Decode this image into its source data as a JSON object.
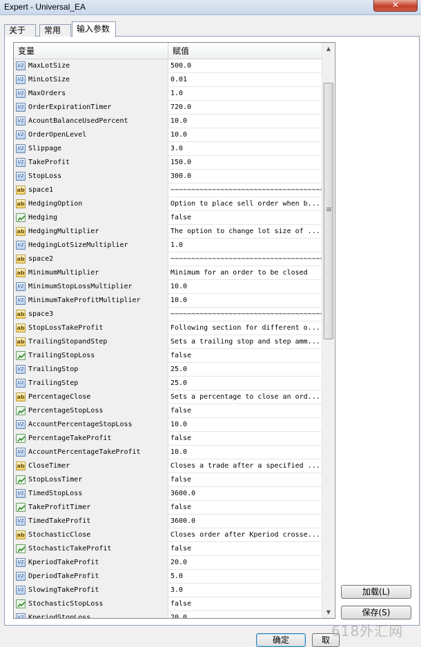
{
  "window": {
    "title": "Expert - Universal_EA",
    "close_label": "✕"
  },
  "tabs": [
    {
      "label": "关于"
    },
    {
      "label": "常用"
    },
    {
      "label": "输入参数"
    }
  ],
  "grid": {
    "col_variable": "变量",
    "col_value": "赋值",
    "rows": [
      {
        "name": "MaxLotSize",
        "value": "500.0",
        "type": "num"
      },
      {
        "name": "MinLotSize",
        "value": "0.01",
        "type": "num"
      },
      {
        "name": "MaxOrders",
        "value": "1.0",
        "type": "num"
      },
      {
        "name": "OrderExpirationTimer",
        "value": "720.0",
        "type": "num"
      },
      {
        "name": "AcountBalanceUsedPercent",
        "value": "10.0",
        "type": "num"
      },
      {
        "name": "OrderOpenLevel",
        "value": "10.0",
        "type": "num"
      },
      {
        "name": "Slippage",
        "value": "3.0",
        "type": "num"
      },
      {
        "name": "TakeProfit",
        "value": "150.0",
        "type": "num"
      },
      {
        "name": "StopLoss",
        "value": "300.0",
        "type": "num"
      },
      {
        "name": "space1",
        "value": "~~~~~~~~~~~~~~~~~~~~~~~~~~~~~~~~~~~~~~...",
        "type": "str"
      },
      {
        "name": "HedgingOption",
        "value": "Option to place sell order when b...",
        "type": "str"
      },
      {
        "name": "Hedging",
        "value": "false",
        "type": "bool"
      },
      {
        "name": "HedgingMultiplier",
        "value": "The option to change lot size of ...",
        "type": "str"
      },
      {
        "name": "HedgingLotSizeMultiplier",
        "value": "1.0",
        "type": "num"
      },
      {
        "name": "space2",
        "value": "~~~~~~~~~~~~~~~~~~~~~~~~~~~~~~~~~~~~~~...",
        "type": "str"
      },
      {
        "name": "MinimumMultiplier",
        "value": "Minimum for an order to be closed",
        "type": "str"
      },
      {
        "name": "MinimumStopLossMultiplier",
        "value": "10.0",
        "type": "num"
      },
      {
        "name": "MinimumTakeProfitMultiplier",
        "value": "10.0",
        "type": "num"
      },
      {
        "name": "space3",
        "value": "~~~~~~~~~~~~~~~~~~~~~~~~~~~~~~~~~~~~~~...",
        "type": "str"
      },
      {
        "name": "StopLossTakeProfit",
        "value": "Following section for different o...",
        "type": "str"
      },
      {
        "name": "TrailingStopandStep",
        "value": "Sets a trailing stop and step amm...",
        "type": "str"
      },
      {
        "name": "TrailingStopLoss",
        "value": "false",
        "type": "bool"
      },
      {
        "name": "TrailingStop",
        "value": "25.0",
        "type": "num"
      },
      {
        "name": "TrailingStep",
        "value": "25.0",
        "type": "num"
      },
      {
        "name": "PercentageClose",
        "value": "Sets a percentage to close an ord...",
        "type": "str"
      },
      {
        "name": "PercentageStopLoss",
        "value": "false",
        "type": "bool"
      },
      {
        "name": "AccountPercentageStopLoss",
        "value": "10.0",
        "type": "num"
      },
      {
        "name": "PercentageTakeProfit",
        "value": "false",
        "type": "bool"
      },
      {
        "name": "AccountPercentageTakeProfit",
        "value": "10.0",
        "type": "num"
      },
      {
        "name": "CloseTimer",
        "value": "Closes a trade after a specified ...",
        "type": "str"
      },
      {
        "name": "StopLossTimer",
        "value": "false",
        "type": "bool"
      },
      {
        "name": "TimedStopLoss",
        "value": "3600.0",
        "type": "num"
      },
      {
        "name": "TakeProfitTimer",
        "value": "false",
        "type": "bool"
      },
      {
        "name": "TimedTakeProfit",
        "value": "3600.0",
        "type": "num"
      },
      {
        "name": "StochasticClose",
        "value": "Closes order after Kperiod crosse...",
        "type": "str"
      },
      {
        "name": "StochasticTakeProfit",
        "value": "false",
        "type": "bool"
      },
      {
        "name": "KperiodTakeProfit",
        "value": "20.0",
        "type": "num"
      },
      {
        "name": "DperiodTakeProfit",
        "value": "5.0",
        "type": "num"
      },
      {
        "name": "SlowingTakeProfit",
        "value": "3.0",
        "type": "num"
      },
      {
        "name": "StochasticStopLoss",
        "value": "false",
        "type": "bool"
      },
      {
        "name": "KperiodStopLoss",
        "value": "20.0",
        "type": "num"
      }
    ]
  },
  "icons": {
    "num": "V2",
    "str": "ab"
  },
  "buttons": {
    "load": "加载(L)",
    "save": "保存(S)",
    "ok": "确定",
    "cancel": "取"
  },
  "watermark": "618外汇网"
}
